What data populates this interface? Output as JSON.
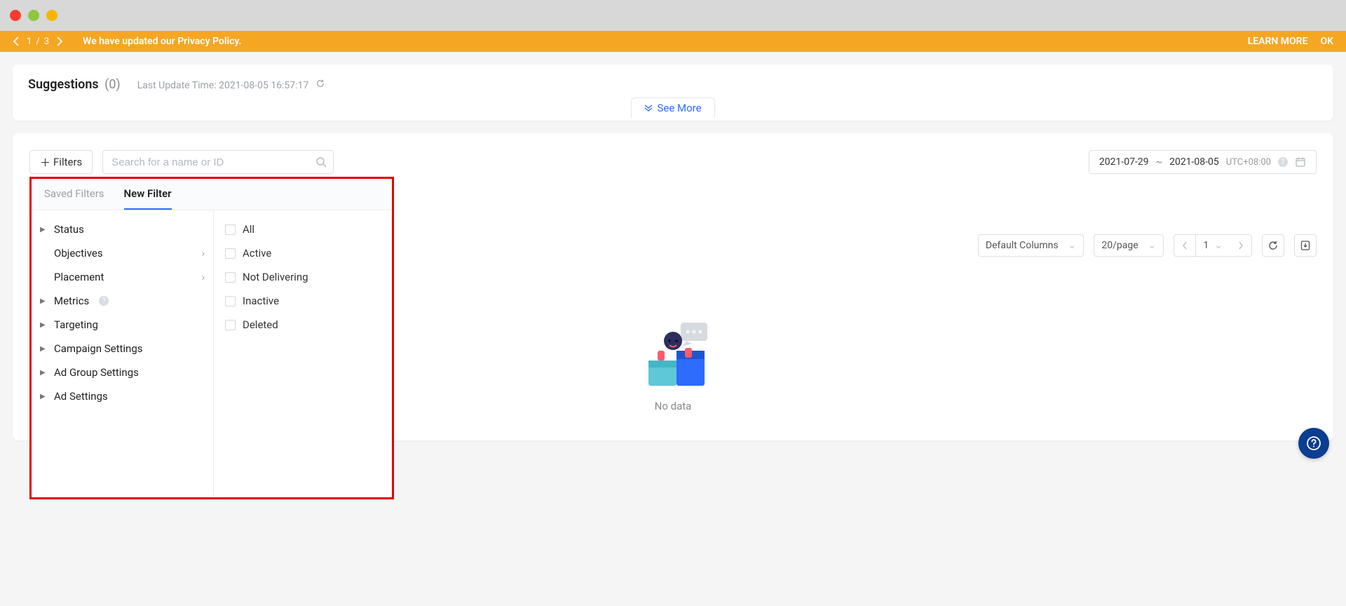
{
  "notice": {
    "page_current": "1",
    "page_sep": "/",
    "page_total": "3",
    "message": "We have updated our Privacy Policy.",
    "learn_more": "LEARN MORE",
    "ok": "OK"
  },
  "suggestions": {
    "title": "Suggestions",
    "count": "(0)",
    "last_update_label": "Last Update Time:",
    "last_update_time": "2021-08-05 16:57:17",
    "see_more": "See More"
  },
  "filters": {
    "button": "Filters",
    "search_placeholder": "Search for a name or ID",
    "tabs": {
      "saved": "Saved Filters",
      "new": "New Filter"
    },
    "categories": [
      {
        "label": "Status",
        "type": "expand"
      },
      {
        "label": "Objectives",
        "type": "chevron"
      },
      {
        "label": "Placement",
        "type": "chevron"
      },
      {
        "label": "Metrics",
        "type": "expand_help"
      },
      {
        "label": "Targeting",
        "type": "expand"
      },
      {
        "label": "Campaign Settings",
        "type": "expand"
      },
      {
        "label": "Ad Group Settings",
        "type": "expand"
      },
      {
        "label": "Ad Settings",
        "type": "expand"
      }
    ],
    "options": [
      "All",
      "Active",
      "Not Delivering",
      "Inactive",
      "Deleted"
    ]
  },
  "date": {
    "from": "2021-07-29",
    "sep": "~",
    "to": "2021-08-05",
    "tz": "UTC+08:00"
  },
  "controls": {
    "columns": "Default Columns",
    "per_page": "20/page",
    "page_num": "1"
  },
  "nodata": "No data"
}
